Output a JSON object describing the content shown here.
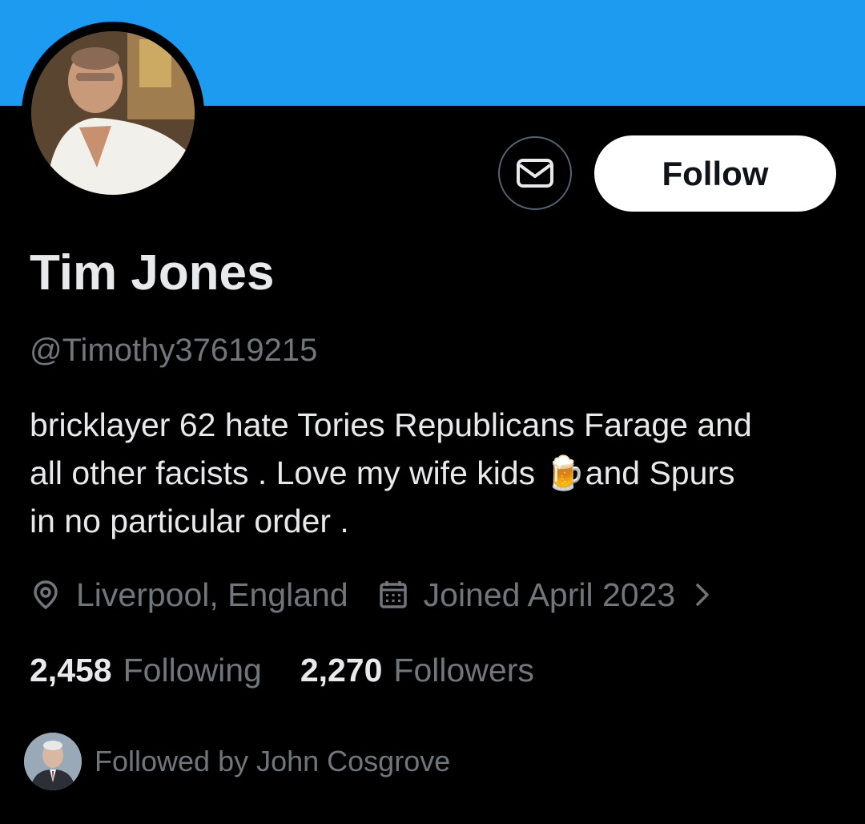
{
  "profile": {
    "name": "Tim Jones",
    "handle": "@Timothy37619215",
    "bio_lines": [
      "bricklayer 62 hate Tories Republicans Farage and",
      "all other facists . Love my wife kids ",
      "in no particular order ."
    ],
    "bio_emoji": "🍺",
    "bio_after_emoji": "and Spurs",
    "location": "Liverpool, England",
    "joined": "Joined April 2023",
    "following_count": "2,458",
    "following_label": "Following",
    "followers_count": "2,270",
    "followers_label": "Followers",
    "followed_by": "Followed by John Cosgrove"
  },
  "actions": {
    "follow_label": "Follow",
    "message_icon": "envelope-icon"
  },
  "icons": {
    "location": "location-pin-icon",
    "joined": "calendar-icon",
    "expand": "chevron-right-icon"
  },
  "colors": {
    "banner": "#1d9bf0",
    "background": "#000000",
    "text_primary": "#e7e9ea",
    "text_secondary": "#71767b",
    "follow_button_bg": "#ffffff",
    "message_button_border": "#536471"
  }
}
